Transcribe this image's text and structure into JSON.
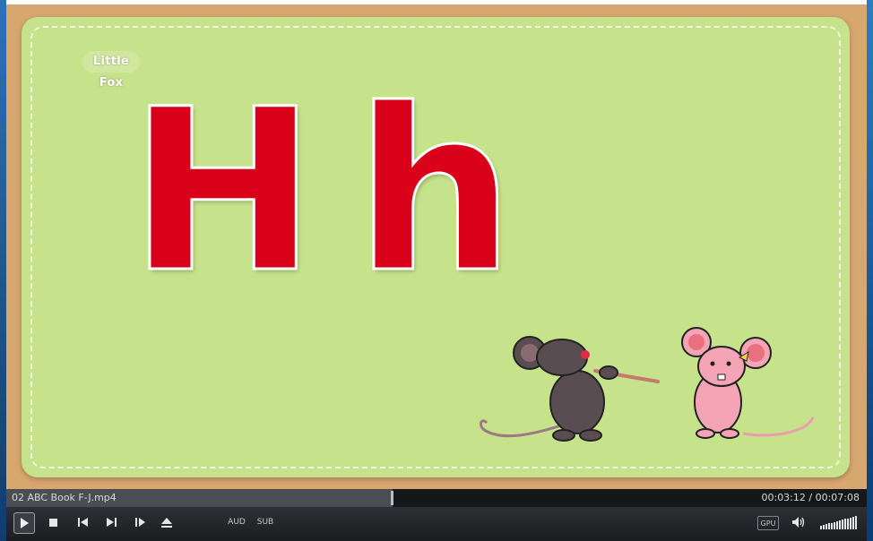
{
  "video": {
    "logo_text": "Little Fox",
    "letter_upper": "H",
    "letter_lower": "h"
  },
  "player": {
    "filename": "02 ABC Book F-J.mp4",
    "time": "00:03:12 / 00:07:08",
    "progress_fraction": 0.449,
    "buttons": {
      "aud": "AUD",
      "sub": "SUB",
      "gpu": "GPU"
    },
    "volume_level": 1.0
  },
  "colors": {
    "card": "#c6e28a",
    "letter": "#d9001a",
    "frame": "#d7a76f"
  },
  "icons": [
    "play-icon",
    "stop-icon",
    "skip-back-icon",
    "skip-forward-icon",
    "frame-step-icon",
    "eject-icon",
    "volume-icon"
  ]
}
